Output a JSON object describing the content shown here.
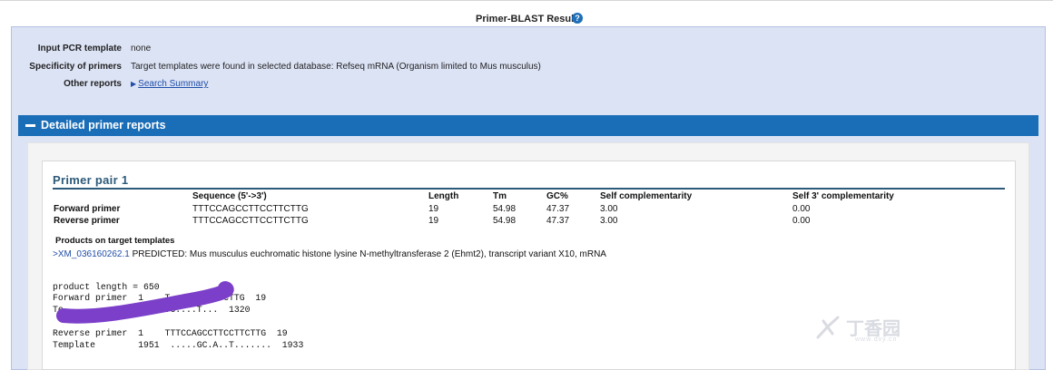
{
  "header": {
    "title": "Primer-BLAST Results",
    "help_glyph": "?"
  },
  "summary": {
    "input_pcr_template_label": "Input PCR template",
    "input_pcr_template_value": "none",
    "specificity_label": "Specificity of primers",
    "specificity_value": "Target templates were found in selected database: Refseq mRNA (Organism limited to Mus musculus)",
    "other_reports_label": "Other reports",
    "search_summary_link": "Search Summary"
  },
  "detailed": {
    "section_title": "Detailed primer reports"
  },
  "primer_pair": {
    "title": "Primer pair 1",
    "columns": [
      "Sequence (5'->3')",
      "Length",
      "Tm",
      "GC%",
      "Self complementarity",
      "Self 3' complementarity"
    ],
    "rows": [
      {
        "name": "Forward primer",
        "sequence": "TTTCCAGCCTTCCTTCTTG",
        "length": "19",
        "tm": "54.98",
        "gc": "47.37",
        "self_comp": "3.00",
        "self3_comp": "0.00"
      },
      {
        "name": "Reverse primer",
        "sequence": "TTTCCAGCCTTCCTTCTTG",
        "length": "19",
        "tm": "54.98",
        "gc": "47.37",
        "self_comp": "3.00",
        "self3_comp": "0.00"
      }
    ],
    "products_heading": "Products on target templates",
    "accession": ">XM_036160262.1",
    "accession_desc": "PREDICTED: Mus musculus euchromatic histone lysine N-methyltransferase 2 (Ehmt2), transcript variant X10, mRNA",
    "alignment": {
      "product_length": "product length = 650",
      "fwd_line": "Forward primer  1    T         TCTTG  19",
      "fwd_template": "Te            .....G..C....T...  1320",
      "rev_line": "Reverse primer  1    TTTCCAGCCTTCCTTCTTG  19",
      "rev_template": "Template        1951  .....GC.A..T.......  1933"
    }
  },
  "watermark": {
    "text": "丁香园",
    "sub": "www.dxy.cn"
  },
  "colors": {
    "accent_blue": "#1a6db7",
    "summary_bg": "#dce3f5",
    "title_teal": "#2c5a7a",
    "scribble_purple": "#7b3fc9"
  }
}
